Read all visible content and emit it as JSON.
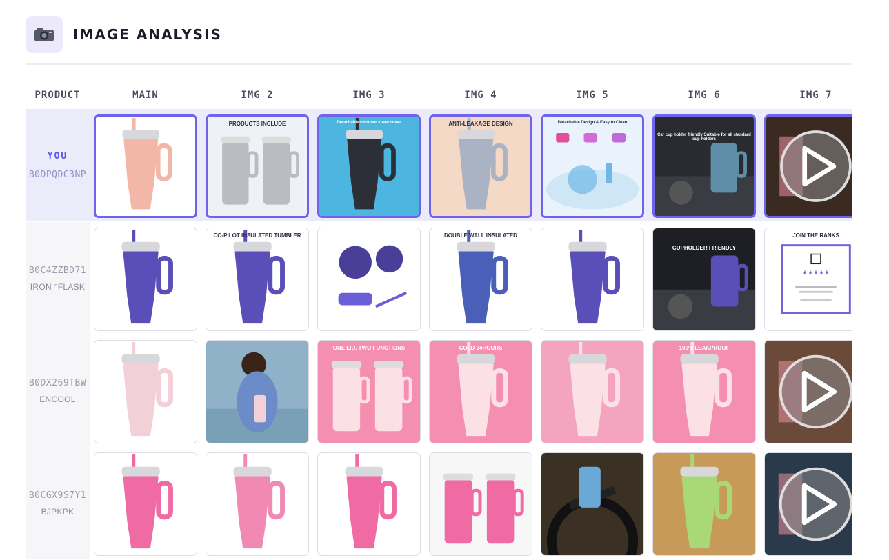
{
  "header": {
    "title": "IMAGE ANALYSIS",
    "icon": "camera-icon"
  },
  "columns": [
    "PRODUCT",
    "MAIN",
    "IMG 2",
    "IMG 3",
    "IMG 4",
    "IMG 5",
    "IMG 6",
    "IMG 7"
  ],
  "rows": [
    {
      "you_label": "YOU",
      "asin": "B0DPQDC3NP",
      "brand": "",
      "images": [
        {
          "name": "main",
          "bg": "#ffffff",
          "cup": "#f2b7a6",
          "kind": "cup"
        },
        {
          "name": "img2",
          "bg": "#eef2f7",
          "cup": "#b9bcc2",
          "kind": "cup2",
          "text": "PRODUCTS INCLUDE"
        },
        {
          "name": "img3",
          "bg": "#4cb6e0",
          "cup": "#2c2f38",
          "kind": "cup",
          "text": "Detachable turnover straw cover"
        },
        {
          "name": "img4",
          "bg": "#f3d9c6",
          "cup": "#a9b3c3",
          "kind": "cup",
          "text": "ANTI-LEAKAGE DESIGN"
        },
        {
          "name": "img5",
          "bg": "#eaf3fb",
          "cup": "#6fb8e6",
          "kind": "splash",
          "text": "Detachable Design & Easy to Clean"
        },
        {
          "name": "img6",
          "bg": "#2a2b30",
          "cup": "#5f8ea8",
          "kind": "car",
          "text": "Car cup holder friendly Suitable for all standard cup holders"
        },
        {
          "name": "img7",
          "bg": "#3a2a22",
          "cup": "#e08a9a",
          "kind": "video"
        }
      ]
    },
    {
      "you_label": "",
      "asin": "B0C4ZZBD71",
      "brand": "IRON °FLASK",
      "images": [
        {
          "name": "main",
          "bg": "#ffffff",
          "cup": "#5a4fb8",
          "kind": "cup"
        },
        {
          "name": "img2",
          "bg": "#ffffff",
          "cup": "#5a4fb8",
          "kind": "cup",
          "text": "CO-PILOT INSULATED TUMBLER"
        },
        {
          "name": "img3",
          "bg": "#ffffff",
          "cup": "#4a3f98",
          "kind": "lids"
        },
        {
          "name": "img4",
          "bg": "#ffffff",
          "cup": "#4a5fb8",
          "kind": "cup",
          "text": "DOUBLE WALL INSULATED"
        },
        {
          "name": "img5",
          "bg": "#ffffff",
          "cup": "#5a4fb8",
          "kind": "cup"
        },
        {
          "name": "img6",
          "bg": "#1e1f24",
          "cup": "#5a4fb8",
          "kind": "car",
          "text": "CUPHOLDER FRIENDLY"
        },
        {
          "name": "img7",
          "bg": "#ffffff",
          "cup": "#7a5fd8",
          "kind": "card",
          "text": "JOIN THE RANKS"
        }
      ]
    },
    {
      "you_label": "",
      "asin": "B0DX269TBW",
      "brand": "ENCOOL",
      "images": [
        {
          "name": "main",
          "bg": "#ffffff",
          "cup": "#f3cfd8",
          "kind": "cup"
        },
        {
          "name": "img2",
          "bg": "#8fb2c8",
          "cup": "#f3cfd8",
          "kind": "person"
        },
        {
          "name": "img3",
          "bg": "#f48fb1",
          "cup": "#fbe0e6",
          "kind": "cup2",
          "text": "ONE LID, TWO FUNCTIONS"
        },
        {
          "name": "img4",
          "bg": "#f48fb1",
          "cup": "#fbe0e6",
          "kind": "cup",
          "text": "COLD 24HOURS"
        },
        {
          "name": "img5",
          "bg": "#f5a4c0",
          "cup": "#fbe0e6",
          "kind": "cup"
        },
        {
          "name": "img6",
          "bg": "#f48fb1",
          "cup": "#fbe0e6",
          "kind": "cup",
          "text": "100% LEAKPROOF"
        },
        {
          "name": "img7",
          "bg": "#6b4a3a",
          "cup": "#e08a9a",
          "kind": "video"
        }
      ]
    },
    {
      "you_label": "",
      "asin": "B0CGX9S7Y1",
      "brand": "BJPKPK",
      "images": [
        {
          "name": "main",
          "bg": "#ffffff",
          "cup": "#f06aa4",
          "kind": "cup"
        },
        {
          "name": "img2",
          "bg": "#ffffff",
          "cup": "#f08ab4",
          "kind": "cup"
        },
        {
          "name": "img3",
          "bg": "#ffffff",
          "cup": "#f06aa4",
          "kind": "cup"
        },
        {
          "name": "img4",
          "bg": "#f7f7f7",
          "cup": "#f06aa4",
          "kind": "cup2"
        },
        {
          "name": "img5",
          "bg": "#3a3024",
          "cup": "#6aa8d8",
          "kind": "bike"
        },
        {
          "name": "img6",
          "bg": "#c89a5a",
          "cup": "#a8d878",
          "kind": "cup"
        },
        {
          "name": "img7",
          "bg": "#2a3a4a",
          "cup": "#e08a9a",
          "kind": "video"
        }
      ]
    }
  ]
}
